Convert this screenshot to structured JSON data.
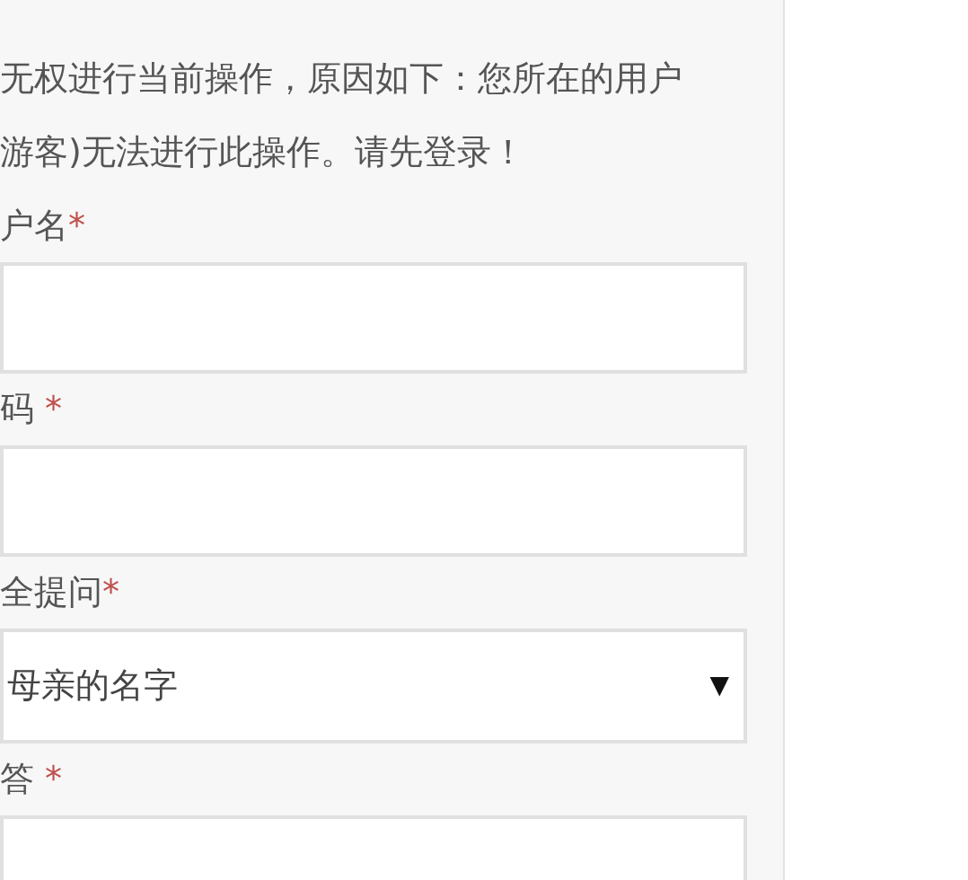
{
  "message": [
    "无权进行当前操作，原因如下：您所在的用户",
    "游客)无法进行此操作。请先登录！"
  ],
  "fields": [
    {
      "kind": "text",
      "label": "户名",
      "required_mark": "*"
    },
    {
      "kind": "text",
      "label": "码",
      "required_mark": " *"
    },
    {
      "kind": "select",
      "label": "全提问",
      "required_mark": "*",
      "value": "母亲的名字",
      "arrow": "▼"
    },
    {
      "kind": "text",
      "label": "答",
      "required_mark": " *"
    }
  ]
}
